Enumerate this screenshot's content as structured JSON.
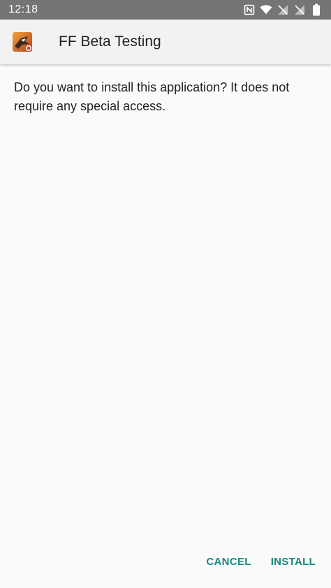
{
  "status_bar": {
    "time": "12:18",
    "icons": [
      "nfc-icon",
      "wifi-icon",
      "signal-off-icon",
      "signal-off-icon",
      "battery-icon"
    ]
  },
  "header": {
    "app_title": "FF Beta Testing",
    "app_icon": "app-icon"
  },
  "body": {
    "message": "Do you want to install this application? It does not require any special access."
  },
  "actions": {
    "cancel_label": "CANCEL",
    "install_label": "INSTALL"
  },
  "colors": {
    "status_bar": "#757575",
    "accent": "#168a7e",
    "background": "#fafafa",
    "text": "#212121"
  }
}
